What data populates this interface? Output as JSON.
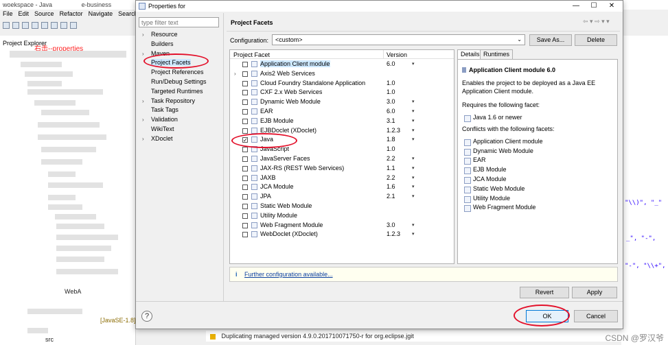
{
  "background": {
    "window_title": "woekspace - Java",
    "window_title_suffix": "e-business",
    "menu": [
      "File",
      "Edit",
      "Source",
      "Refactor",
      "Navigate",
      "Search"
    ],
    "explorer_tab": "Project Explorer",
    "annotation": "右击--properties",
    "tree_frag_1": "WebA",
    "tree_frag_2": "[JavaSE-1.8]",
    "tree_frag_3": "src",
    "code_fragments": [
      "\"\\\\)\", \"_\"",
      "_\", \"-\",",
      "\"-\", \"\\\\+\","
    ],
    "status_message": "Duplicating managed version 4.9.0.201710071750-r for org.eclipse.jgit",
    "watermark": "CSDN @罗汉爷"
  },
  "dialog": {
    "title": "Properties for",
    "filter_placeholder": "type filter text",
    "nav_items": [
      {
        "label": "Resource",
        "expandable": true
      },
      {
        "label": "Builders",
        "expandable": false
      },
      {
        "label": "Maven",
        "expandable": true
      },
      {
        "label": "Project Facets",
        "expandable": false,
        "selected": true
      },
      {
        "label": "Project References",
        "expandable": false
      },
      {
        "label": "Run/Debug Settings",
        "expandable": false
      },
      {
        "label": "Targeted Runtimes",
        "expandable": false
      },
      {
        "label": "Task Repository",
        "expandable": true
      },
      {
        "label": "Task Tags",
        "expandable": false
      },
      {
        "label": "Validation",
        "expandable": true
      },
      {
        "label": "WikiText",
        "expandable": false
      },
      {
        "label": "XDoclet",
        "expandable": true
      }
    ],
    "page_title": "Project Facets",
    "nav_arrows": "⇦ ▾ ⇨ ▾ ▾",
    "configuration_label": "Configuration:",
    "configuration_value": "<custom>",
    "save_as_button": "Save As...",
    "delete_button": "Delete",
    "facet_columns": {
      "name": "Project Facet",
      "version": "Version"
    },
    "facets": [
      {
        "name": "Application Client module",
        "version": "6.0",
        "checked": false,
        "expand": false,
        "dropdown": true,
        "highlight": true
      },
      {
        "name": "Axis2 Web Services",
        "version": "",
        "checked": false,
        "expand": true,
        "dropdown": false
      },
      {
        "name": "Cloud Foundry Standalone Application",
        "version": "1.0",
        "checked": false,
        "expand": false,
        "dropdown": false
      },
      {
        "name": "CXF 2.x Web Services",
        "version": "1.0",
        "checked": false,
        "expand": false,
        "dropdown": false
      },
      {
        "name": "Dynamic Web Module",
        "version": "3.0",
        "checked": false,
        "expand": false,
        "dropdown": true
      },
      {
        "name": "EAR",
        "version": "6.0",
        "checked": false,
        "expand": false,
        "dropdown": true
      },
      {
        "name": "EJB Module",
        "version": "3.1",
        "checked": false,
        "expand": false,
        "dropdown": true
      },
      {
        "name": "EJBDoclet (XDoclet)",
        "version": "1.2.3",
        "checked": false,
        "expand": false,
        "dropdown": true
      },
      {
        "name": "Java",
        "version": "1.8",
        "checked": true,
        "expand": false,
        "dropdown": true
      },
      {
        "name": "JavaScript",
        "version": "1.0",
        "checked": false,
        "expand": false,
        "dropdown": false
      },
      {
        "name": "JavaServer Faces",
        "version": "2.2",
        "checked": false,
        "expand": false,
        "dropdown": true
      },
      {
        "name": "JAX-RS (REST Web Services)",
        "version": "1.1",
        "checked": false,
        "expand": false,
        "dropdown": true
      },
      {
        "name": "JAXB",
        "version": "2.2",
        "checked": false,
        "expand": false,
        "dropdown": true
      },
      {
        "name": "JCA Module",
        "version": "1.6",
        "checked": false,
        "expand": false,
        "dropdown": true
      },
      {
        "name": "JPA",
        "version": "2.1",
        "checked": false,
        "expand": false,
        "dropdown": true
      },
      {
        "name": "Static Web Module",
        "version": "",
        "checked": false,
        "expand": false,
        "dropdown": false
      },
      {
        "name": "Utility Module",
        "version": "",
        "checked": false,
        "expand": false,
        "dropdown": false
      },
      {
        "name": "Web Fragment Module",
        "version": "3.0",
        "checked": false,
        "expand": false,
        "dropdown": true
      },
      {
        "name": "WebDoclet (XDoclet)",
        "version": "1.2.3",
        "checked": false,
        "expand": false,
        "dropdown": true
      }
    ],
    "details_tab": "Details",
    "runtimes_tab": "Runtimes",
    "details_title": "Application Client module 6.0",
    "details_description": "Enables the project to be deployed as a Java EE Application Client module.",
    "requires_label": "Requires the following facet:",
    "requires": [
      "Java 1.6 or newer"
    ],
    "conflicts_label": "Conflicts with the following facets:",
    "conflicts": [
      "Application Client module",
      "Dynamic Web Module",
      "EAR",
      "EJB Module",
      "JCA Module",
      "Static Web Module",
      "Utility Module",
      "Web Fragment Module"
    ],
    "further_link": "Further configuration available...",
    "revert_button": "Revert",
    "apply_button": "Apply",
    "ok_button": "OK",
    "cancel_button": "Cancel",
    "help_icon": "?"
  },
  "colors": {
    "annotation_red": "#e3102a",
    "selection": "#cde8ff",
    "link": "#0b3fa0"
  }
}
